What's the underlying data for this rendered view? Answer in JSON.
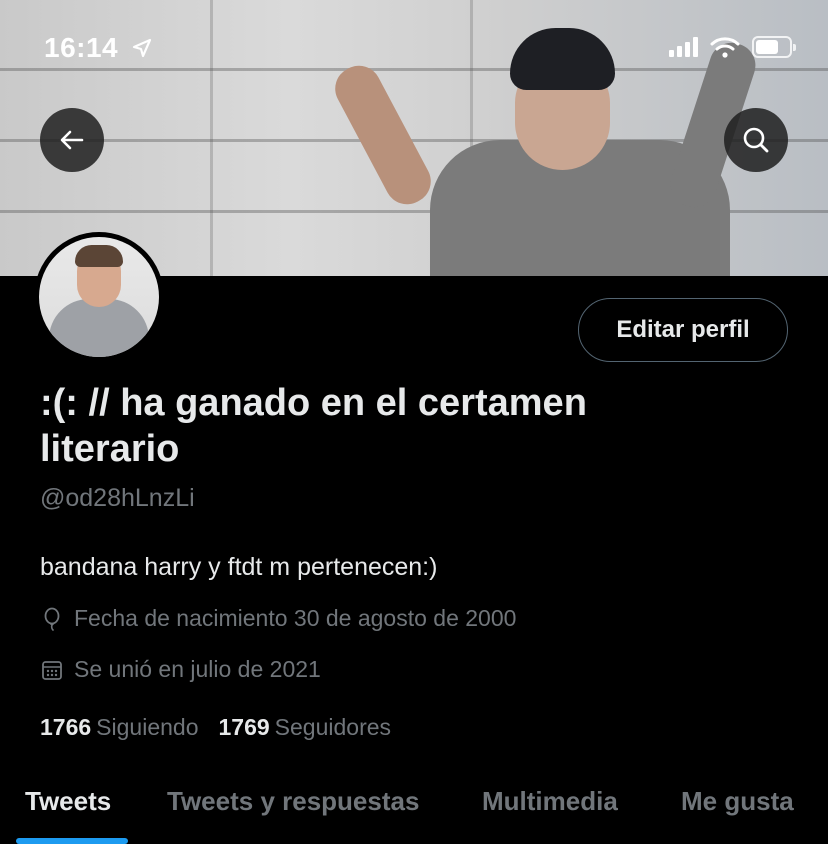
{
  "status_bar": {
    "time": "16:14",
    "icons": [
      "location-arrow-icon",
      "cellular-signal-icon",
      "wifi-icon",
      "battery-icon"
    ]
  },
  "header": {
    "back_icon": "arrow-left-icon",
    "search_icon": "search-icon"
  },
  "profile": {
    "edit_button_label": "Editar perfil",
    "display_name": ":(: // ha ganado en el certamen literario",
    "handle": "@od28hLnzLi",
    "bio": "bandana harry y ftdt m pertenecen:)",
    "birthdate": "Fecha de nacimiento 30 de agosto de 2000",
    "joined": "Se unió en julio de 2021",
    "following_count": "1766",
    "following_label": "Siguiendo",
    "followers_count": "1769",
    "followers_label": "Seguidores"
  },
  "tabs": [
    {
      "label": "Tweets",
      "active": true
    },
    {
      "label": "Tweets y respuestas",
      "active": false
    },
    {
      "label": "Multimedia",
      "active": false
    },
    {
      "label": "Me gusta",
      "active": false
    }
  ],
  "colors": {
    "background": "#000000",
    "primary_text": "#e7e9ea",
    "secondary_text": "#71767b",
    "accent": "#1d9bf0",
    "border": "#536471"
  }
}
